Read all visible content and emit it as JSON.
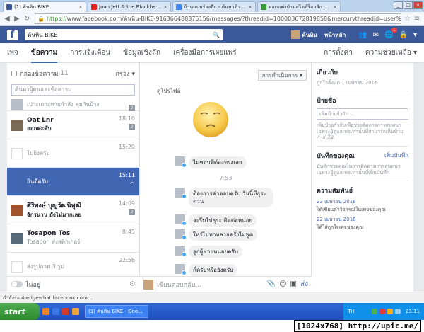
{
  "browser": {
    "tabs": [
      {
        "title": "(1) ค้นหิน BIKE",
        "icon_color": "#3b5998",
        "active": true
      },
      {
        "title": "Joan Jett & the Blackheart...",
        "icon_color": "#e62117",
        "active": false
      },
      {
        "title": "บ้านแบบร้องลีก - ค้นหาด้วย Go...",
        "icon_color": "#4285f4",
        "active": false
      },
      {
        "title": "ดอกแต่งบ้านสไตล์ร็อยสัก ลัดก...",
        "icon_color": "#3a9a3a",
        "active": false
      }
    ],
    "tab_close": "×",
    "url_https": "https://",
    "url_rest": "www.facebook.com/ค้นหิน-BIKE-916366488375156/messages/?threadid=100003672819858&mercurythreadid=user%3A100000",
    "status_url": "กำลังรอ 4-edge-chat.facebook.com..."
  },
  "fb": {
    "search_value": "ค้นหิน BIKE",
    "profile_name": "ค้นหิน",
    "home_label": "หน้าหลัก",
    "notif_count": "1",
    "subnav": {
      "left": [
        "เพจ",
        "ข้อความ",
        "การแจ้งเตือน",
        "ข้อมูลเชิงลึก",
        "เครื่องมือการเผยแพร่"
      ],
      "right": [
        "การตั้งค่า",
        "ความช่วยเหลือ ▾"
      ]
    }
  },
  "inbox": {
    "header_label": "กล่องข้อความ",
    "header_count": "11",
    "filter_label": "กรอง ▾",
    "search_placeholder": "ค้นหาผู้คนและข้อความ",
    "conversations": [
      {
        "name": "",
        "preview": "เปาะเดาะทายกำลัง คุยกันบ้าง",
        "time": "",
        "badge": "2",
        "partial": true,
        "selected": false,
        "avatar": "#b8bfc9",
        "unread": false
      },
      {
        "name": "Oat Lnr",
        "preview": "ออกค่ะคับ",
        "time": "18:10",
        "badge": "2",
        "partial": false,
        "selected": false,
        "avatar": "#7a6a55",
        "unread": true
      },
      {
        "name": "",
        "preview": "ไม่ยิงครับ",
        "time": "15:20",
        "badge": "",
        "partial": false,
        "selected": false,
        "avatar": "#ffffff",
        "unread": false
      },
      {
        "name": "",
        "preview": "ยินดีครับ",
        "time": "15:11",
        "badge": "↶",
        "partial": false,
        "selected": true,
        "avatar": "#4267b2",
        "unread": false
      },
      {
        "name": "ศิริพงษ์ บุญวัฒนิพุฒิ",
        "preview": "จักรนาน ถังไม่มากเลย",
        "time": "14:09",
        "badge": "2",
        "partial": false,
        "selected": false,
        "avatar": "#a0522d",
        "unread": true
      },
      {
        "name": "Tosapon Tos",
        "preview": "Tosapon ส่งสติกเกอร์",
        "time": "8:45",
        "badge": "",
        "partial": false,
        "selected": false,
        "avatar": "#556b7a",
        "unread": false
      },
      {
        "name": "",
        "preview": "ส่งรูปภาพ 3 รูป",
        "time": "22:56",
        "badge": "",
        "partial": false,
        "selected": false,
        "avatar": "#ffffff",
        "unread": false
      }
    ],
    "footer_label": "ไม่อยู่",
    "footer_gear": "⚙"
  },
  "thread": {
    "actions_label": "การดำเนินการ ▾",
    "profile_label": "ดูโปรไฟล์",
    "messages": [
      {
        "text": "ไม่ชอบที่ต้องทรงเลย"
      },
      {
        "text": "ต้องการค่าตอบครับ วันนี้มีธุระด่วน"
      },
      {
        "text": "จะรีบไปธุระ ติดต่อหน่อย"
      },
      {
        "text": "ใหร่ไปหาหลายครั้งไม่พูด"
      },
      {
        "text": "ลูกผู้ชายหน่อยครับ"
      },
      {
        "text": "กี่ครับหรือยังครับ"
      }
    ],
    "time_sep": "7:53",
    "composer_placeholder": "เขียนตอบกลับ...",
    "composer_icons": [
      "📎",
      "☺",
      "▣"
    ],
    "send_label": "ส่ง"
  },
  "info": {
    "about_title": "เกี่ยวกับ",
    "about_sub": "ถูกใจตั้งแต่ 1 เมษายน 2016",
    "label_title": "ป้ายชื่อ",
    "label_placeholder": "เพิ่มป้ายกำกับ...",
    "label_help": "เพิ่มป้ายกำกับเพื่อช่วยจัดการการสนทนา เฉพาะผู้ดูแลเพจเท่านั้นที่สามารถเห็นป้ายกำกับได้",
    "notes_title": "บันทึกของคุณ",
    "notes_link": "เพิ่มบันทึก",
    "notes_help": "บันทึกช่วยคุณในการติดตามการสนทนา เฉพาะผู้ดูแลเพจเท่านั้นที่เห็นบันทึก",
    "activity_title": "ความสัมพันธ์",
    "activity": [
      {
        "date": "23 เมษายน 2016",
        "text": "ได้เขียนคำวิจารณ์ในเพจของคุณ"
      },
      {
        "date": "22 เมษายน 2016",
        "text": "ได้ใส่ถูกใจเพจของคุณ"
      }
    ]
  },
  "taskbar": {
    "start": "start",
    "window_item": "(1) ค้นหิน BIKE - Goo...",
    "lang": "TH",
    "clock": "23:11",
    "quick_colors": [
      "#e8862a",
      "#3b78e7",
      "#d03c2a",
      "#f2a33a"
    ]
  },
  "watermark": "[1024x768] http://upic.me/"
}
